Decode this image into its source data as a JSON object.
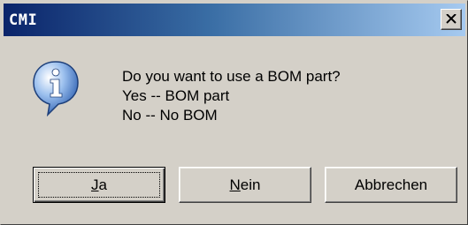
{
  "window": {
    "title": "CMI",
    "close_symbol": "X"
  },
  "icon": {
    "name": "information-icon",
    "glyph": "i",
    "colors": {
      "bubble": "#5b8fd6",
      "glyph": "#ffffff"
    }
  },
  "message": {
    "line1": "Do you want to use a BOM part?",
    "line2": "Yes -- BOM part",
    "line3": "No -- No BOM"
  },
  "buttons": {
    "yes": {
      "accel": "J",
      "rest": "a"
    },
    "no": {
      "accel": "N",
      "rest": "ein"
    },
    "cancel": {
      "label": "Abbrechen"
    }
  },
  "colors": {
    "titlebar_start": "#0a246a",
    "titlebar_end": "#a6caf0",
    "face": "#d4d0c8"
  }
}
